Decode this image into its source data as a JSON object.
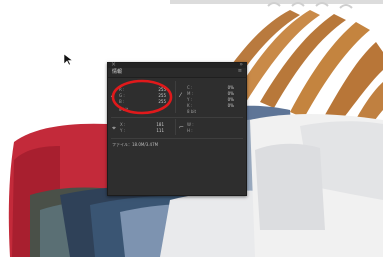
{
  "info_panel": {
    "title": "情報",
    "menu_icon": "panel-menu-icon",
    "close_icon": "close-icon",
    "collapse_icon": "collapse-icon",
    "rgb": {
      "mode_label": "8 bit",
      "r_label": "R :",
      "r_value": "255",
      "g_label": "G :",
      "g_value": "255",
      "b_label": "B :",
      "b_value": "255"
    },
    "cmyk": {
      "mode_label": "8 bit",
      "c_label": "C :",
      "c_value": "0%",
      "m_label": "M :",
      "m_value": "0%",
      "y_label": "Y :",
      "y_value": "0%",
      "k_label": "K :",
      "k_value": "0%"
    },
    "position": {
      "x_label": "X :",
      "x_value": "181",
      "y_label": "Y :",
      "y_value": "111"
    },
    "size": {
      "w_label": "W :",
      "w_value": "",
      "h_label": "H :",
      "h_value": ""
    },
    "file_info": "ファイル：18.0M/3.47M",
    "highlight_color": "#e0191b"
  }
}
